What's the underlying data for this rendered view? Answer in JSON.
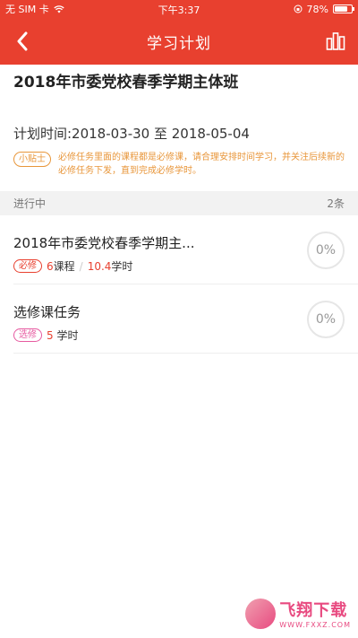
{
  "status_bar": {
    "carrier": "无 SIM 卡",
    "time": "下午3:37",
    "battery": "78%",
    "battery_level": 0.78
  },
  "nav": {
    "title": "学习计划",
    "back_icon": "chevron-left-icon",
    "chart_icon": "bar-chart-icon"
  },
  "course": {
    "title": "2018年市委党校春季学期主体班",
    "plan_time": "计划时间:2018-03-30 至 2018-05-04",
    "tip_badge": "小贴士",
    "tip_text": "必修任务里面的课程都是必修课，请合理安排时间学习，并关注后续新的必修任务下发，直到完成必修学时。"
  },
  "section": {
    "label": "进行中",
    "count": "2条"
  },
  "tasks": [
    {
      "name": "2018年市委党校春季学期主...",
      "tag": "必修",
      "courses_num": "6",
      "courses_unit": "课程",
      "separator": "/",
      "hours_num": "10.4",
      "hours_unit": "学时",
      "progress": "0%"
    },
    {
      "name": "选修课任务",
      "tag": "选修",
      "hours_num": "5",
      "hours_unit": " 学时",
      "progress": "0%"
    }
  ],
  "watermark": {
    "main": "飞翔下载",
    "sub": "WWW.FXXZ.COM"
  },
  "colors": {
    "brand": "#e8402f",
    "tip": "#e8963a",
    "elective": "#e65aa0"
  }
}
